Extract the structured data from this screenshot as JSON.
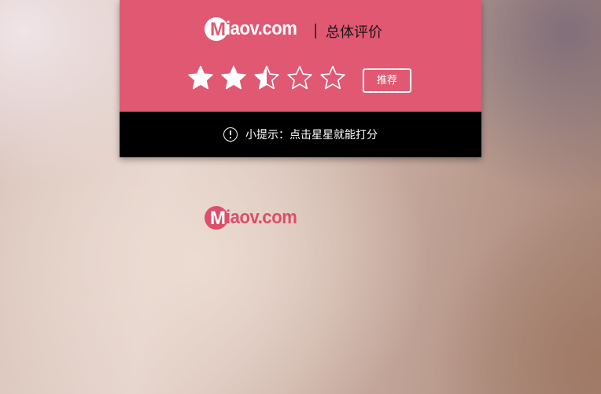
{
  "logo": {
    "badge_letter": "M",
    "text": "iaov.com"
  },
  "header": {
    "divider": "|",
    "title": "总体评价"
  },
  "rating": {
    "value": 2.5,
    "max": 5,
    "star_color": "#ffffff"
  },
  "recommend_button": {
    "label": "推荐"
  },
  "tip": {
    "icon": "exclamation-circle-icon",
    "text": "小提示：点击星星就能打分"
  },
  "footer_logo": {
    "badge_letter": "M",
    "text": "iaov.com"
  },
  "colors": {
    "accent": "#e15873",
    "tip_bar": "#000000"
  }
}
